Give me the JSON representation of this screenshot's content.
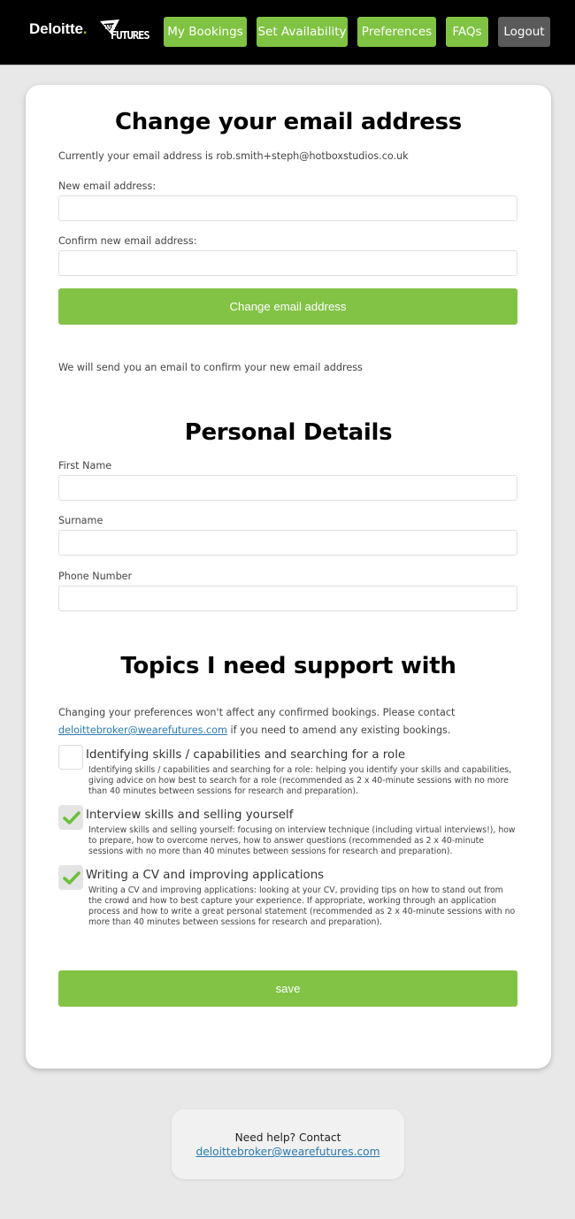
{
  "header": {
    "logo_text": "Deloitte",
    "logo_dot": ".",
    "partner_logo": "wearefutures-logo",
    "nav": [
      {
        "label": "My Bookings",
        "style": "green"
      },
      {
        "label": "Set Availability",
        "style": "green"
      },
      {
        "label": "Preferences",
        "style": "green"
      },
      {
        "label": "FAQs",
        "style": "green"
      },
      {
        "label": "Logout",
        "style": "grey"
      }
    ]
  },
  "colors": {
    "accent_green": "#82c346",
    "logout_grey": "#5a5a5a",
    "link_blue": "#2a7ab0",
    "background": "#e7e8e7"
  },
  "email_section": {
    "title": "Change your email address",
    "current_text": "Currently your email address is rob.smith+steph@hotboxstudios.co.uk",
    "new_email_label": "New email address:",
    "new_email_value": "",
    "confirm_email_label": "Confirm new email address:",
    "confirm_email_value": "",
    "submit_label": "Change email address",
    "note": "We will send you an email to confirm your new email address"
  },
  "personal_details": {
    "title": "Personal Details",
    "first_name_label": "First Name",
    "first_name_value": "",
    "surname_label": "Surname",
    "surname_value": "",
    "phone_label": "Phone Number",
    "phone_value": ""
  },
  "topics": {
    "title": "Topics I need support with",
    "intro_before": "Changing your preferences won't affect any confirmed bookings. Please contact",
    "intro_link": "deloittebroker@wearefutures.com",
    "intro_after": " if you need to amend any existing bookings.",
    "items": [
      {
        "title": "Identifying skills / capabilities and searching for a role",
        "description": "Identifying skills / capabilities and searching for a role: helping you identify your skills and capabilities, giving advice on how best to search for a role (recommended as 2 x 40-minute sessions with no more than 40 minutes between sessions for research and preparation).",
        "checked": false
      },
      {
        "title": "Interview skills and selling yourself",
        "description": "Interview skills and selling yourself: focusing on interview technique (including virtual interviews!), how to prepare, how to overcome nerves, how to answer questions (recommended as 2 x 40-minute sessions with no more than 40 minutes between sessions for research and preparation).",
        "checked": true
      },
      {
        "title": "Writing a CV and improving applications",
        "description": "Writing a CV and improving applications: looking at your CV, providing tips on how to stand out from the crowd and how to best capture your experience. If appropriate, working through an application process and how to write a great personal statement (recommended as 2 x 40-minute sessions with no more than 40 minutes between sessions for research and preparation).",
        "checked": true
      }
    ],
    "save_label": "save"
  },
  "help": {
    "text": "Need help? Contact",
    "email": "deloittebroker@wearefutures.com"
  }
}
